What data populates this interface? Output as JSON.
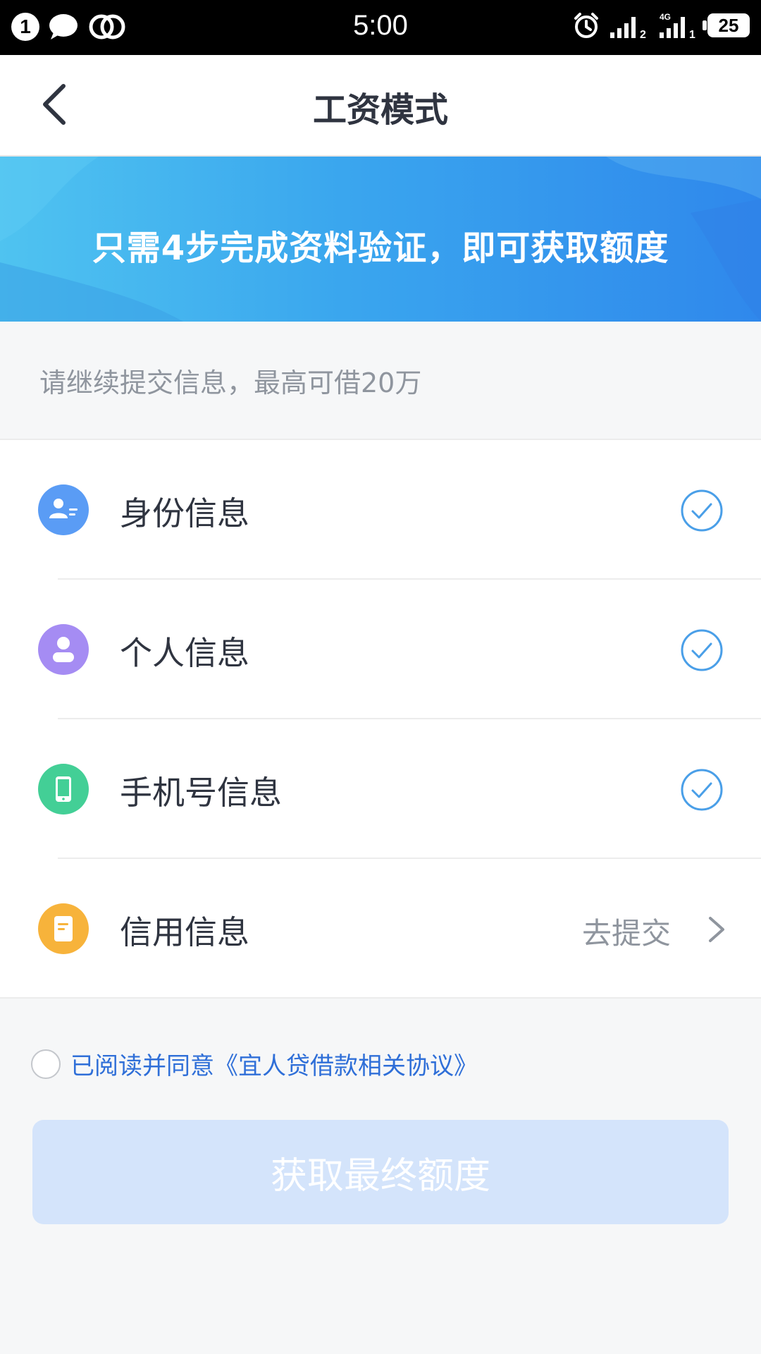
{
  "status_bar": {
    "notification_count": "1",
    "time": "5:00",
    "network_label": "4G",
    "sim1_label": "2",
    "sim2_label": "1",
    "battery_level": "25"
  },
  "navbar": {
    "title": "工资模式"
  },
  "banner": {
    "text": "只需4步完成资料验证，即可获取额度"
  },
  "hint": "请继续提交信息，最高可借20万",
  "steps": [
    {
      "label": "身份信息",
      "status": "completed",
      "icon": "id-card-icon",
      "color": "#5a9cf5"
    },
    {
      "label": "个人信息",
      "status": "completed",
      "icon": "person-icon",
      "color": "#a58cf3"
    },
    {
      "label": "手机号信息",
      "status": "completed",
      "icon": "phone-icon",
      "color": "#43cf96"
    },
    {
      "label": "信用信息",
      "status": "pending",
      "icon": "document-icon",
      "color": "#f7b33b",
      "action": "去提交"
    }
  ],
  "agreement": {
    "text": "已阅读并同意《宜人贷借款相关协议》",
    "checked": false
  },
  "submit_button": {
    "label": "获取最终额度",
    "enabled": false
  },
  "colors": {
    "accent": "#3aa6ee",
    "check": "#4a9fe8",
    "link": "#2f6fd8",
    "button_disabled": "#d4e4fb"
  }
}
